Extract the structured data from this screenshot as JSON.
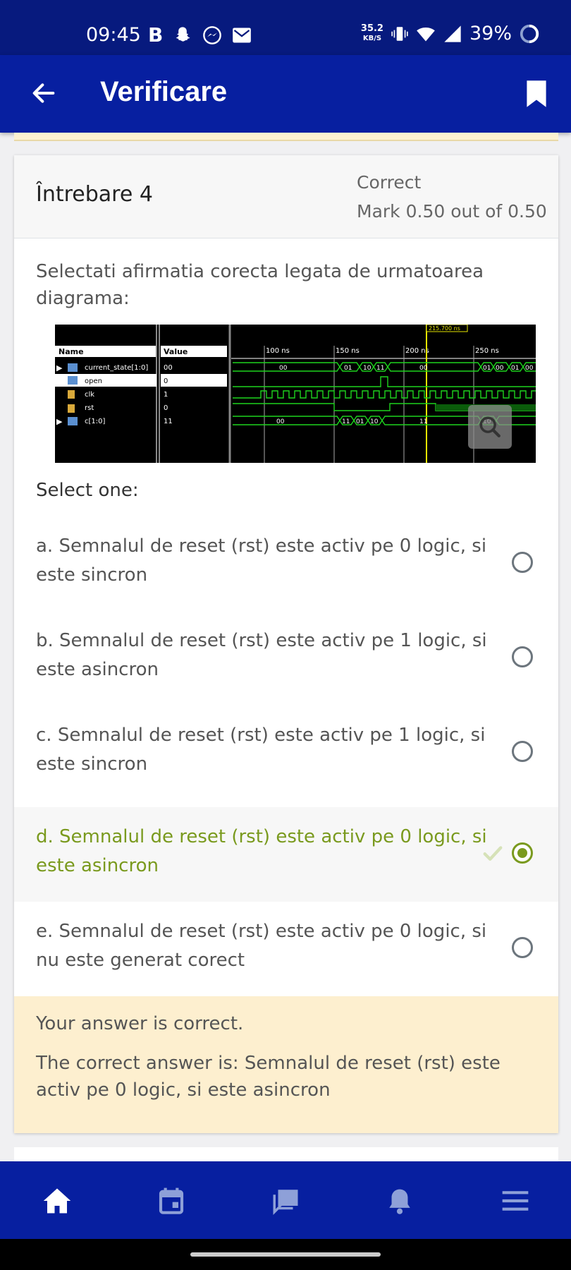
{
  "status_bar": {
    "time": "09:45",
    "left_icons": [
      "B",
      "snapchat-icon",
      "messenger-icon",
      "gmail-icon"
    ],
    "speed_value": "35.2",
    "speed_unit": "KB/S",
    "battery": "39%"
  },
  "app_bar": {
    "title": "Verificare"
  },
  "question": {
    "title": "Întrebare 4",
    "state": "Correct",
    "grade": "Mark 0.50 out of 0.50",
    "text": "Selectati afirmatia corecta legata de urmatoarea diagrama:",
    "select_one": "Select one:"
  },
  "diagram": {
    "cursor_label": "215.700 ns",
    "col_name": "Name",
    "col_value": "Value",
    "signals": [
      {
        "name": "current_state[1:0]",
        "value": "00"
      },
      {
        "name": "open",
        "value": "0"
      },
      {
        "name": "clk",
        "value": "1"
      },
      {
        "name": "rst",
        "value": "0"
      },
      {
        "name": "c[1:0]",
        "value": "11"
      }
    ],
    "time_ticks": [
      "100 ns",
      "150 ns",
      "200 ns",
      "250 ns"
    ],
    "state_labels": [
      "00",
      "01",
      "10",
      "11",
      "00",
      "01",
      "00",
      "01",
      "00"
    ],
    "c_labels": [
      "00",
      "11",
      "01",
      "10",
      "11",
      "10"
    ]
  },
  "options": [
    {
      "label": "a. Semnalul de reset (rst) este activ pe 0 logic, si este sincron",
      "selected": false
    },
    {
      "label": "b. Semnalul de reset (rst) este activ pe 1 logic, si este asincron",
      "selected": false
    },
    {
      "label": "c. Semnalul de reset (rst) este activ pe 1 logic, si este sincron",
      "selected": false
    },
    {
      "label": "d. Semnalul de reset (rst) este activ pe 0 logic, si este asincron",
      "selected": true
    },
    {
      "label": "e. Semnalul de reset (rst) este activ pe 0 logic, si nu este generat corect",
      "selected": false
    }
  ],
  "feedback": {
    "result": "Your answer is correct.",
    "correct_answer": "The correct answer is: Semnalul de reset (rst) este activ pe 0 logic, si este asincron"
  },
  "bottom_nav": [
    "home-icon",
    "calendar-icon",
    "messages-icon",
    "notifications-icon",
    "menu-icon"
  ],
  "colors": {
    "app_bar": "#071fa0",
    "status_bar": "#071a7e",
    "correct_green": "#7a9a1e",
    "feedback_bg": "#fdefcf"
  }
}
